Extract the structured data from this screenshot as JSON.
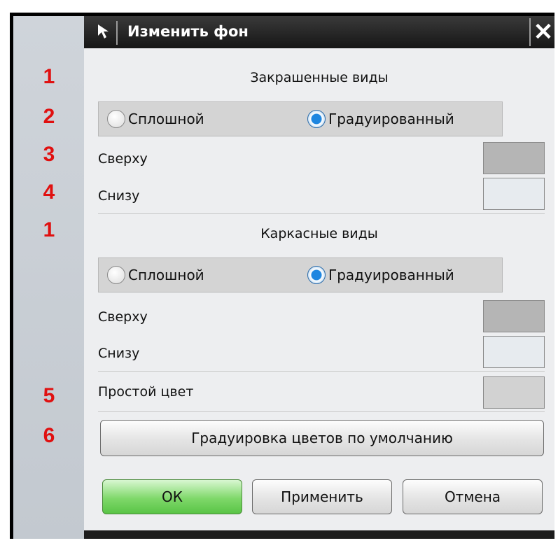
{
  "dialog": {
    "title": "Изменить фон",
    "close_glyph": "✕"
  },
  "annotations": [
    "1",
    "2",
    "3",
    "4",
    "1",
    "5",
    "6"
  ],
  "shaded": {
    "title": "Закрашенные виды",
    "option_solid": "Сплошной",
    "option_graded": "Градуированный",
    "selected": "Градуированный",
    "top_label": "Сверху",
    "top_color": "#b5b5b5",
    "bottom_label": "Снизу",
    "bottom_color": "#e7ebef"
  },
  "wireframe": {
    "title": "Каркасные виды",
    "option_solid": "Сплошной",
    "option_graded": "Градуированный",
    "selected": "Градуированный",
    "top_label": "Сверху",
    "top_color": "#b5b5b5",
    "bottom_label": "Снизу",
    "bottom_color": "#e7ebef"
  },
  "plain": {
    "label": "Простой цвет",
    "color": "#d2d2d2"
  },
  "default_button": "Градуировка цветов по умолчанию",
  "footer": {
    "ok": "ОК",
    "apply": "Применить",
    "cancel": "Отмена"
  }
}
